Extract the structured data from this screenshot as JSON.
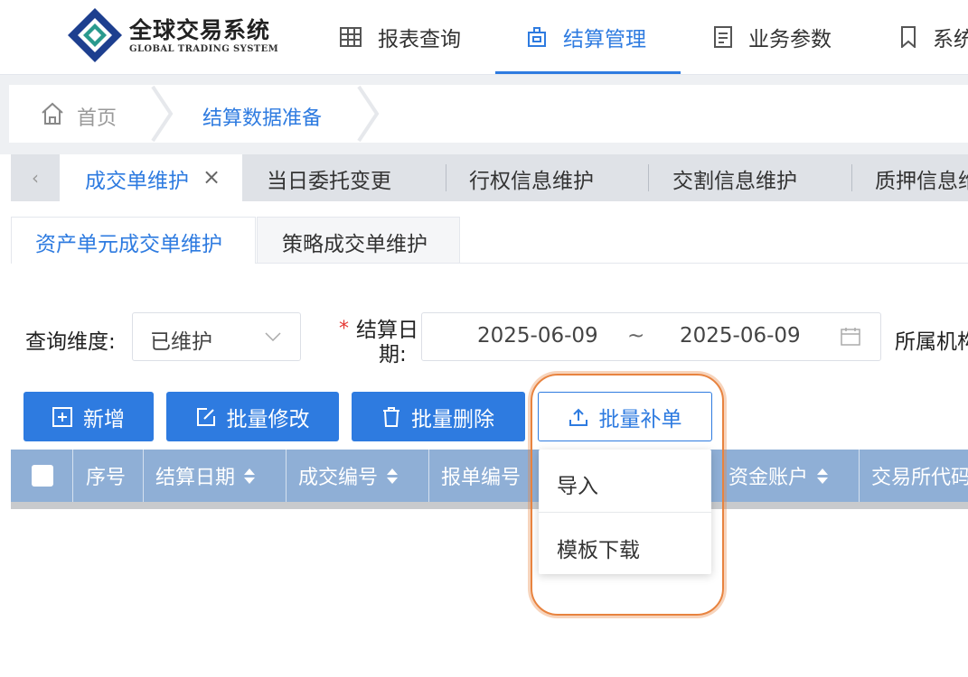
{
  "logo": {
    "title_cn": "全球交易系统",
    "title_en": "GLOBAL TRADING SYSTEM"
  },
  "nav": {
    "items": [
      {
        "label": "报表查询",
        "icon": "table-grid-icon"
      },
      {
        "label": "结算管理",
        "icon": "settlement-icon"
      },
      {
        "label": "业务参数",
        "icon": "document-list-icon"
      },
      {
        "label": "系统",
        "icon": "bookmark-icon"
      }
    ],
    "active_index": 1
  },
  "breadcrumb": {
    "home": "首页",
    "current": "结算数据准备"
  },
  "tabs": {
    "items": [
      "成交单维护",
      "当日委托变更",
      "行权信息维护",
      "交割信息维护",
      "质押信息维"
    ],
    "active_index": 0,
    "close_glyph": "×",
    "prev_glyph": "‹"
  },
  "subtabs": {
    "items": [
      "资产单元成交单维护",
      "策略成交单维护"
    ],
    "active_index": 0
  },
  "filters": {
    "dimension_label": "查询维度:",
    "dimension_value": "已维护",
    "required_mark": "*",
    "date_label_line1": "结算日",
    "date_label_line2": "期:",
    "date_start": "2025-06-09",
    "date_separator": "~",
    "date_end": "2025-06-09",
    "org_label": "所属机构"
  },
  "buttons": {
    "add": "新增",
    "batch_edit": "批量修改",
    "batch_delete": "批量删除",
    "batch_supplement": "批量补单"
  },
  "table": {
    "columns": [
      "序号",
      "结算日期",
      "成交编号",
      "报单编号",
      "资金账户",
      "交易所代码"
    ]
  },
  "dropdown": {
    "items": [
      "导入",
      "模板下载"
    ]
  },
  "colors": {
    "primary": "#2e7be0",
    "table_header": "#8fafd6",
    "highlight": "#e8833f",
    "required": "#e53935"
  }
}
